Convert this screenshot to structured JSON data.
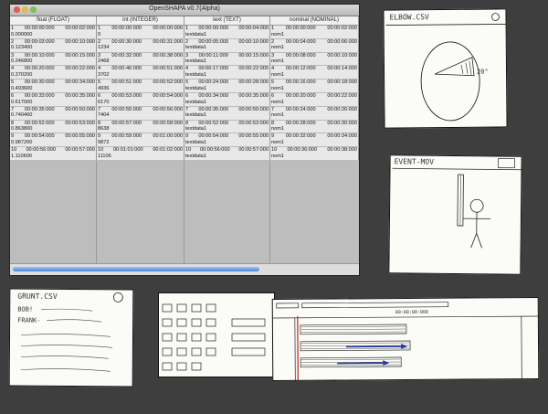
{
  "window": {
    "title": "OpenSHAPA v0.7(Alpha)",
    "columns": [
      "float (FLOAT)",
      "int (INTEGER)",
      "text (TEXT)",
      "nominal (NOMINAL)"
    ],
    "rows": [
      {
        "c": [
          [
            "1",
            "00:00:00:000",
            "00:00:02:000",
            "0.000000"
          ],
          [
            "1",
            "00:00:00:000",
            "00:00:00:000",
            "0"
          ],
          [
            "1",
            "00:00:00:000",
            "00:00:04:000",
            "textdata1"
          ],
          [
            "1",
            "00:00:00:000",
            "00:00:02:000",
            "nom1"
          ]
        ]
      },
      {
        "c": [
          [
            "2",
            "00:00:03:000",
            "00:00:10:000",
            "0.123400"
          ],
          [
            "2",
            "00:00:30:000",
            "00:00:31:000",
            "1234"
          ],
          [
            "2",
            "00:00:05:000",
            "00:00:10:000",
            "textdata1"
          ],
          [
            "2",
            "00:00:04:000",
            "00:00:06:000",
            "nom1"
          ]
        ]
      },
      {
        "c": [
          [
            "3",
            "00:00:10:000",
            "00:00:15:000",
            "0.246800"
          ],
          [
            "3",
            "00:00:32:000",
            "00:00:38:000",
            "2468"
          ],
          [
            "3",
            "00:00:11:000",
            "00:00:15:000",
            "textdata1"
          ],
          [
            "3",
            "00:00:08:000",
            "00:00:10:000",
            "nom1"
          ]
        ]
      },
      {
        "c": [
          [
            "4",
            "00:00:20:000",
            "00:00:22:000",
            "0.370200"
          ],
          [
            "4",
            "00:00:46:000",
            "00:00:51:000",
            "3702"
          ],
          [
            "4",
            "00:00:17:000",
            "00:00:22:000",
            "textdata1"
          ],
          [
            "4",
            "00:00:12:000",
            "00:00:14:000",
            "nom1"
          ]
        ]
      },
      {
        "c": [
          [
            "5",
            "00:00:30:000",
            "00:00:34:000",
            "0.493600"
          ],
          [
            "5",
            "00:00:51:000",
            "00:00:52:000",
            "4936"
          ],
          [
            "5",
            "00:00:24:000",
            "00:00:28:000",
            "textdata1"
          ],
          [
            "5",
            "00:00:16:000",
            "00:00:18:000",
            "nom1"
          ]
        ]
      },
      {
        "c": [
          [
            "6",
            "00:00:33:000",
            "00:00:35:000",
            "0.617000"
          ],
          [
            "6",
            "00:00:53:000",
            "00:00:54:000",
            "6170"
          ],
          [
            "6",
            "00:00:34:000",
            "00:00:35:000",
            "textdata1"
          ],
          [
            "6",
            "00:00:20:000",
            "00:00:22:000",
            "nom1"
          ]
        ]
      },
      {
        "c": [
          [
            "7",
            "00:00:35:000",
            "00:00:50:000",
            "0.740400"
          ],
          [
            "7",
            "00:00:55:000",
            "00:00:56:000",
            "7404"
          ],
          [
            "7",
            "00:00:35:000",
            "00:00:50:000",
            "textdata1"
          ],
          [
            "7",
            "00:00:24:000",
            "00:00:26:000",
            "nom1"
          ]
        ]
      },
      {
        "c": [
          [
            "8",
            "00:00:52:000",
            "00:00:53:000",
            "0.863800"
          ],
          [
            "8",
            "00:00:57:000",
            "00:00:58:000",
            "8638"
          ],
          [
            "8",
            "00:00:52:000",
            "00:00:53:000",
            "textdata1"
          ],
          [
            "8",
            "00:00:28:000",
            "00:00:30:000",
            "nom1"
          ]
        ]
      },
      {
        "c": [
          [
            "9",
            "00:00:54:000",
            "00:00:55:000",
            "0.987200"
          ],
          [
            "9",
            "00:00:59:000",
            "00:01:00:000",
            "9872"
          ],
          [
            "9",
            "00:00:54:000",
            "00:00:55:000",
            "textdata1"
          ],
          [
            "9",
            "00:00:32:000",
            "00:00:34:000",
            "nom1"
          ]
        ]
      },
      {
        "c": [
          [
            "10",
            "00:00:56:000",
            "00:00:57:000",
            "1.110600"
          ],
          [
            "10",
            "00:01:01:000",
            "00:01:02:000",
            "11106"
          ],
          [
            "10",
            "00:00:56:000",
            "00:00:57:000",
            "textdata1"
          ],
          [
            "10",
            "00:00:36:000",
            "00:00:38:000",
            "nom1"
          ]
        ]
      }
    ]
  },
  "sketches": {
    "elbow": {
      "title": "ELBOW.CSV",
      "angle": "20°"
    },
    "event": {
      "title": "EVENT-MOV"
    },
    "grunt": {
      "title": "GRUNT.CSV",
      "lines": [
        "BOB!",
        "FRANK-"
      ]
    },
    "timeline": {
      "stamp": "00:00:00:000",
      "stamp2": "00:00:00:000",
      "stamp3": "00:00:00:000"
    }
  }
}
